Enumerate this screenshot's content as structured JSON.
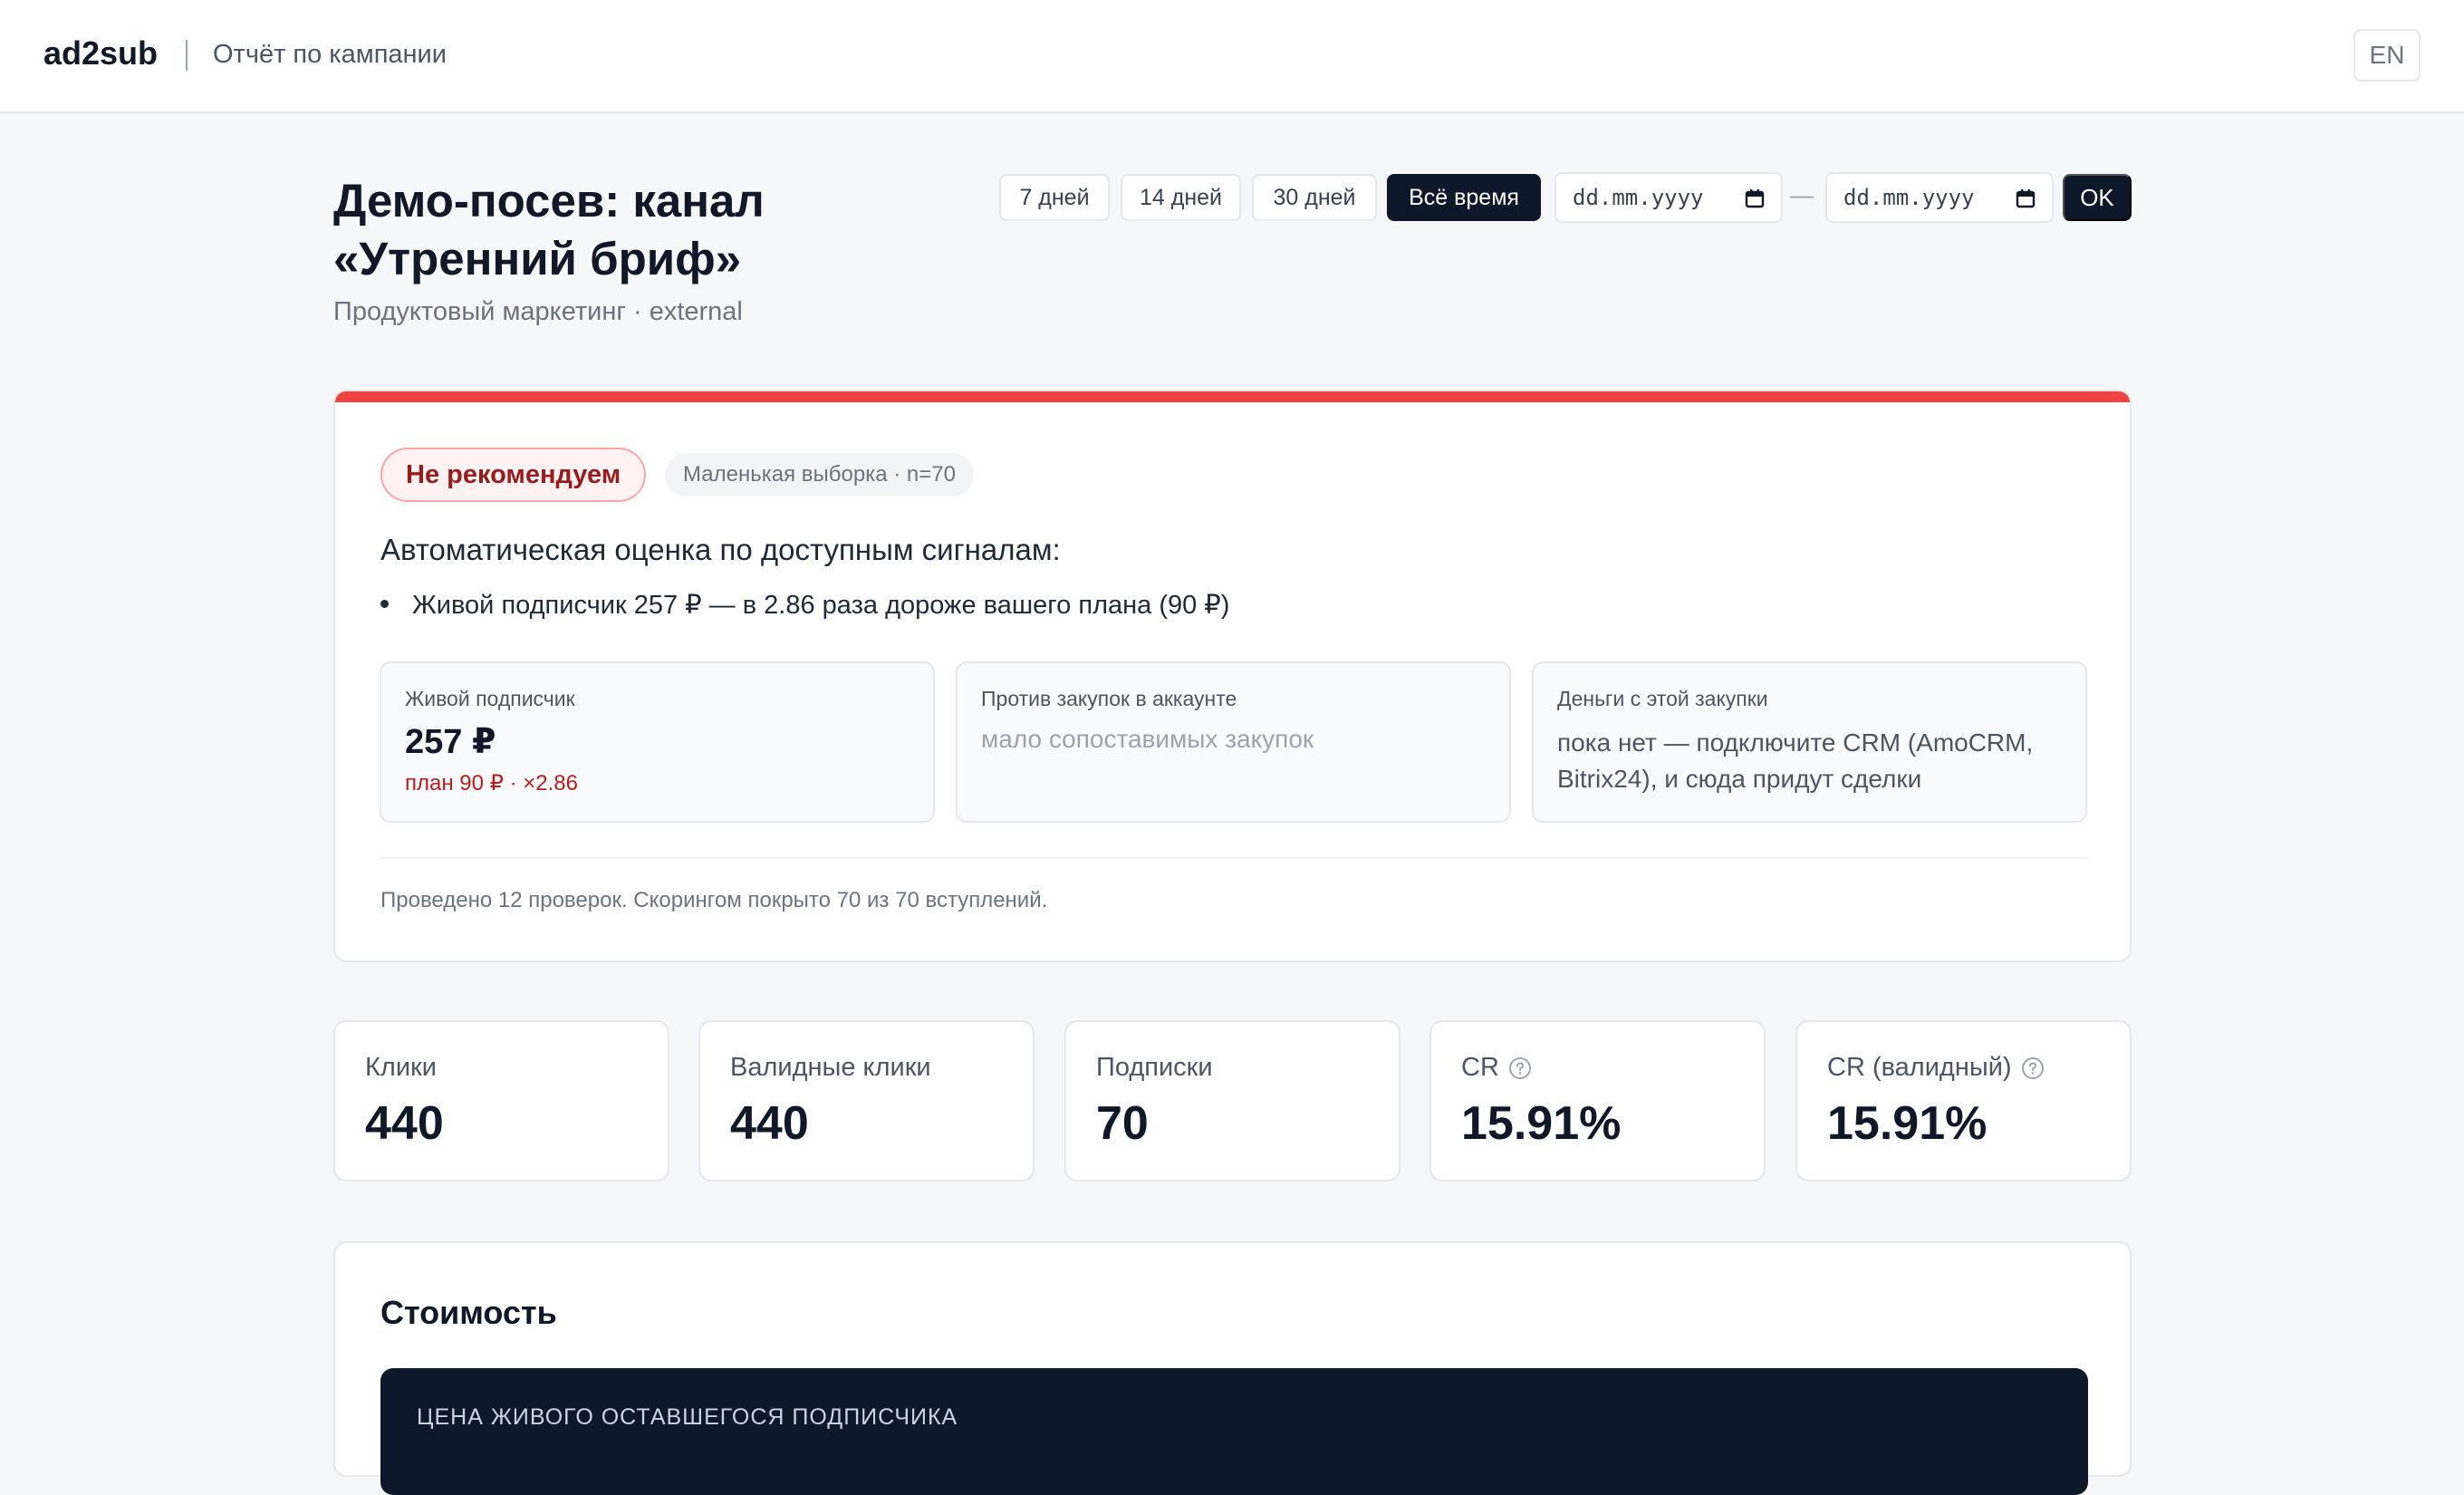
{
  "header": {
    "brand": "ad2sub",
    "subtitle": "Отчёт по кампании",
    "lang_button": "EN"
  },
  "page": {
    "title": "Демо-посев: канал «Утренний бриф»",
    "subtitle": "Продуктовый маркетинг · external"
  },
  "period": {
    "buttons": [
      {
        "label": "7 дней",
        "active": false
      },
      {
        "label": "14 дней",
        "active": false
      },
      {
        "label": "30 дней",
        "active": false
      },
      {
        "label": "Всё время",
        "active": true
      }
    ],
    "date_from_placeholder": "dd.mm.yyyy",
    "date_to_placeholder": "dd.mm.yyyy",
    "separator": "—",
    "ok_label": "OK"
  },
  "verdict": {
    "accent_color": "#ef4444",
    "status_badge": "Не рекомендуем",
    "sample_badge": "Маленькая выборка · n=70",
    "intro": "Автоматическая оценка по доступным сигналам:",
    "bullets": [
      "Живой подписчик 257 ₽ — в 2.86 раза дороже вашего плана (90 ₽)"
    ],
    "metric_cards": [
      {
        "label": "Живой подписчик",
        "value": "257 ₽",
        "note": "план 90 ₽ · ×2.86"
      },
      {
        "label": "Против закупок в аккаунте",
        "value": "мало сопоставимых закупок"
      },
      {
        "label": "Деньги с этой закупки",
        "value": "пока нет — подключите CRM (AmoCRM, Bitrix24), и сюда придут сделки"
      }
    ],
    "footer": "Проведено 12 проверок. Скорингом покрыто 70 из 70 вступлений."
  },
  "kpis": [
    {
      "label": "Клики",
      "value": "440",
      "help": false
    },
    {
      "label": "Валидные клики",
      "value": "440",
      "help": false
    },
    {
      "label": "Подписки",
      "value": "70",
      "help": false
    },
    {
      "label": "CR",
      "value": "15.91%",
      "help": true
    },
    {
      "label": "CR (валидный)",
      "value": "15.91%",
      "help": true
    }
  ],
  "cost": {
    "title": "Стоимость",
    "panel_label": "ЦЕНА ЖИВОГО ОСТАВШЕГОСЯ ПОДПИСЧИКА"
  }
}
